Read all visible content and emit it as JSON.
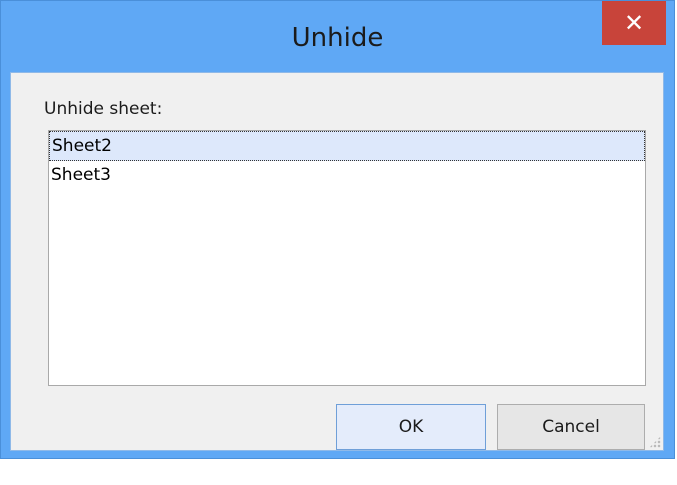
{
  "window": {
    "title": "Unhide",
    "close_glyph": "✕"
  },
  "dialog": {
    "prompt_label": "Unhide sheet:",
    "sheets": [
      {
        "label": "Sheet2",
        "selected": true
      },
      {
        "label": "Sheet3",
        "selected": false
      }
    ],
    "ok_label": "OK",
    "cancel_label": "Cancel"
  },
  "colors": {
    "titlebar": "#5fa8f5",
    "close_button": "#c8443a",
    "selection": "#dde8fb"
  }
}
